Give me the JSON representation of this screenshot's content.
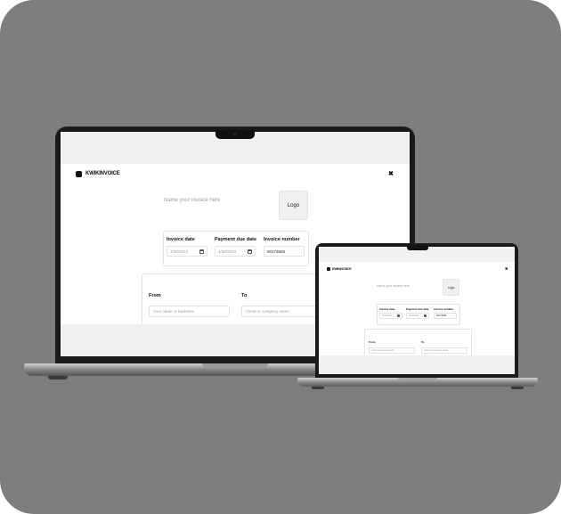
{
  "app": {
    "brand_name": "KWIKINVOICE",
    "close_symbol": "✖",
    "invoice_title_placeholder": "Name your invoice here",
    "logo_label": "Logo",
    "invoice_date_label": "Invoice date",
    "invoice_date_value": "3/30/2023",
    "payment_due_date_label": "Payment due date",
    "payment_due_date_value": "3/30/2023",
    "invoice_number_label": "Invoice number",
    "invoice_number_value": "00173828",
    "from_label": "From",
    "from_placeholder": "Your name or business",
    "to_label": "To",
    "to_placeholder": "Client or company name"
  },
  "icons": {
    "brand": "square-logo-icon",
    "close": "close-icon",
    "calendar": "calendar-icon"
  },
  "colors": {
    "background": "#7d7d7d",
    "bezel": "#1a1a1a",
    "screen": "#f1f1f1",
    "accent": "#111111"
  }
}
